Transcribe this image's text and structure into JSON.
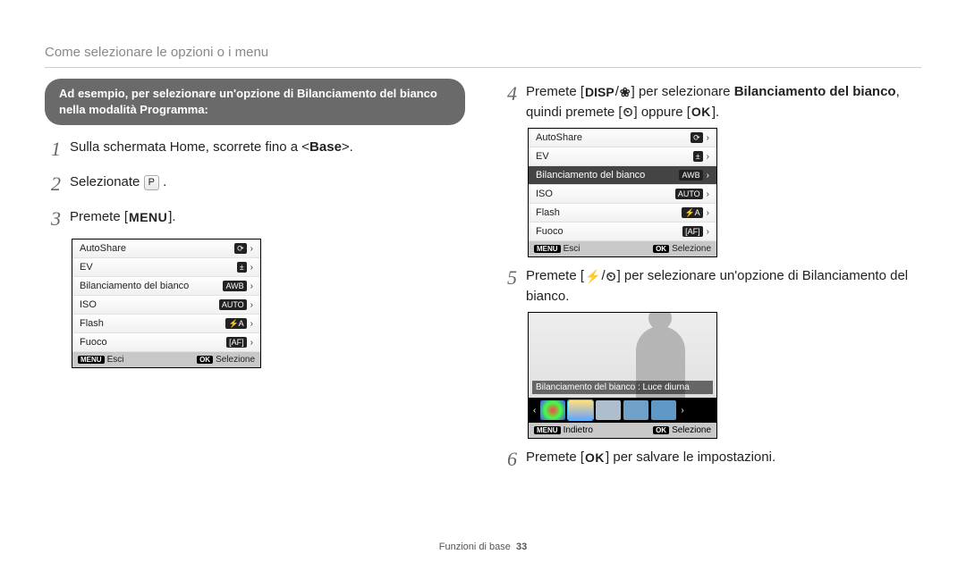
{
  "pageTitle": "Come selezionare le opzioni o i menu",
  "callout": "Ad esempio, per selezionare un'opzione di Bilanciamento del bianco nella modalità Programma:",
  "steps": {
    "s1": {
      "num": "1",
      "text": "Sulla schermata Home, scorrete fino a <Base>."
    },
    "s2": {
      "num": "2",
      "pre": "Selezionate ",
      "iconHint": "P",
      "post": "."
    },
    "s3": {
      "num": "3",
      "pre": "Premete [",
      "key": "MENU",
      "post": "]."
    },
    "s4": {
      "num": "4",
      "pre": "Premete [",
      "k1": "DISP",
      "sep": "/",
      "k2": "❀",
      "mid1": "] per selezionare ",
      "bold": "Bilanciamento del bianco",
      "mid2": ", quindi premete [",
      "k3": "⏲",
      "mid3": "] oppure [",
      "k4": "OK",
      "post": "]."
    },
    "s5": {
      "num": "5",
      "pre": "Premete [",
      "k1": "⚡",
      "sep": "/",
      "k2": "⏲",
      "post": "] per selezionare un'opzione di Bilanciamento del bianco."
    },
    "s6": {
      "num": "6",
      "pre": "Premete [",
      "k1": "OK",
      "post": "] per salvare le impostazioni."
    }
  },
  "menu": {
    "items": [
      {
        "label": "AutoShare",
        "badge": "⟳"
      },
      {
        "label": "EV",
        "badge": "±"
      },
      {
        "label": "Bilanciamento del bianco",
        "badge": "AWB"
      },
      {
        "label": "ISO",
        "badge": "AUTO"
      },
      {
        "label": "Flash",
        "badge": "⚡A"
      },
      {
        "label": "Fuoco",
        "badge": "[AF]"
      }
    ],
    "footerLeft": "Esci",
    "footerLeftChip": "MENU",
    "footerRight": "Selezione",
    "footerRightChip": "OK",
    "selectedIndex": 2
  },
  "wb": {
    "label": "Bilanciamento del bianco : Luce diurna",
    "footerLeftChip": "MENU",
    "footerLeft": "Indietro",
    "footerRightChip": "OK",
    "footerRight": "Selezione"
  },
  "pageFooter": {
    "label": "Funzioni di base",
    "pageNum": "33"
  }
}
